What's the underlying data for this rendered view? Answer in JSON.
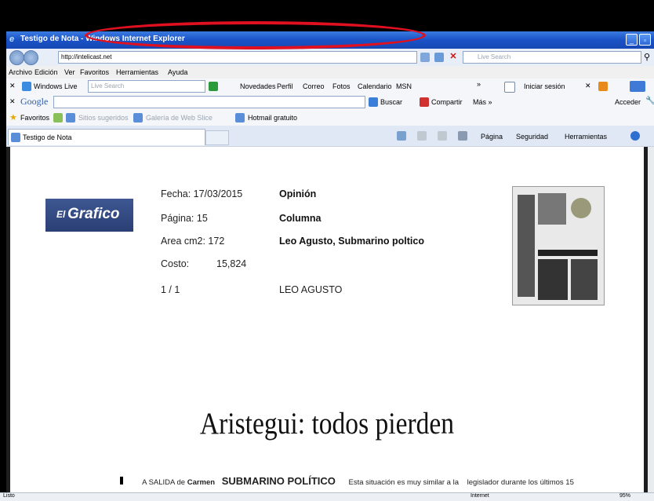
{
  "window": {
    "title": "Testigo de Nota - Windows Internet Explorer",
    "ie_logo": "e"
  },
  "address_bar": {
    "url": "http://intelicast.net",
    "search_placeholder": "Live Search"
  },
  "menu": [
    "Archivo",
    "Edición",
    "Ver",
    "Favoritos",
    "Herramientas",
    "Ayuda"
  ],
  "live_toolbar": {
    "brand": "Windows Live",
    "search_placeholder": "Live Search",
    "links": [
      "Novedades",
      "Perfil",
      "Correo",
      "Fotos",
      "Calendario",
      "MSN"
    ],
    "more": "»",
    "signin": "Iniciar sesión"
  },
  "google_toolbar": {
    "brand": "Google",
    "buscar": "Buscar",
    "compartir": "Compartir",
    "mas": "Más »",
    "acceder": "Acceder"
  },
  "favorites_bar": {
    "label": "Favoritos",
    "items": [
      "Sitios sugeridos",
      "Galería de Web Slice",
      "Hotmail gratuito"
    ]
  },
  "tab": {
    "title": "Testigo de Nota",
    "commands": [
      "Página",
      "Seguridad",
      "Herramientas"
    ]
  },
  "note": {
    "logo_small": "El",
    "logo_big": "Grafico",
    "fecha": "Fecha: 17/03/2015",
    "pagina": "Página: 15",
    "area": "Area cm2: 172",
    "costo_label": "Costo:",
    "costo_value": "15,824",
    "pages": "1 / 1",
    "section": "Opinión",
    "type": "Columna",
    "title": "Leo Agusto, Submarino poltico",
    "author": "LEO AGUSTO"
  },
  "article": {
    "headline": "Aristegui: todos pierden",
    "col1": "A SALIDA de",
    "col1b": "Carmen",
    "kicker": "SUBMARINO POLÍTICO",
    "col2": "Esta situación es muy similar a la",
    "col3": "legislador durante los últimos 15"
  },
  "status_bar": {
    "left": "Listo",
    "zone": "Internet",
    "zoom": "95%"
  },
  "colors": {
    "annotation_oval": "#e01020",
    "titlebar": "#1a52c6",
    "logo_bg": "#2a3f74"
  }
}
